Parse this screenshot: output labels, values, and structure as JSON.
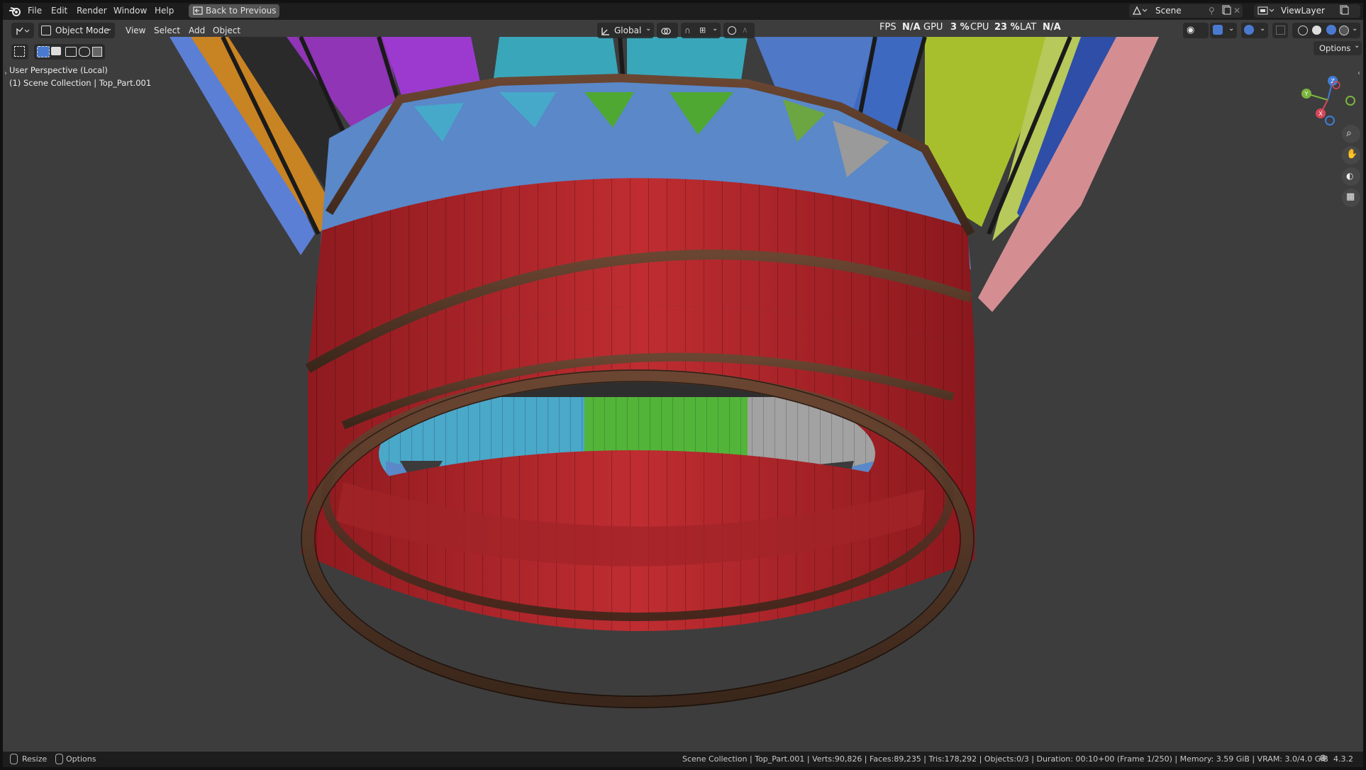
{
  "topbar": {
    "menus": [
      "File",
      "Edit",
      "Render",
      "Window",
      "Help"
    ],
    "back_button": "Back to Previous",
    "scene_label": "Scene",
    "viewlayer_label": "ViewLayer"
  },
  "header": {
    "mode": "Object Mode",
    "menus": [
      "View",
      "Select",
      "Add",
      "Object"
    ],
    "orientation": "Global",
    "options_label": "Options"
  },
  "perf": {
    "fps_label": "FPS",
    "fps_value": "N/A",
    "gpu_label": "GPU",
    "gpu_value": "3 %",
    "cpu_label": "CPU",
    "cpu_value": "23 %",
    "lat_label": "LAT",
    "lat_value": "N/A"
  },
  "overlay": {
    "perspective": "User Perspective (Local)",
    "collection": "(1) Scene Collection | Top_Part.001"
  },
  "gizmo": {
    "x_axis": "X",
    "y_axis": "Y",
    "z_axis": "Z"
  },
  "status": {
    "left_resize": "Resize",
    "left_options": "Options",
    "stats": "Scene Collection | Top_Part.001 | Verts:90,826 | Faces:89,235 | Tris:178,292 | Objects:0/3 | Duration: 00:10+00 (Frame 1/250) | Memory: 3.59 GiB | VRAM: 3.0/4.0 GiB",
    "version": "4.3.2"
  },
  "colors": {
    "red_band": "#b2262b",
    "blue_band": "#5d86c9",
    "rim": "#4a3122",
    "cyan": "#3ea4c4",
    "green": "#4fb02b"
  }
}
